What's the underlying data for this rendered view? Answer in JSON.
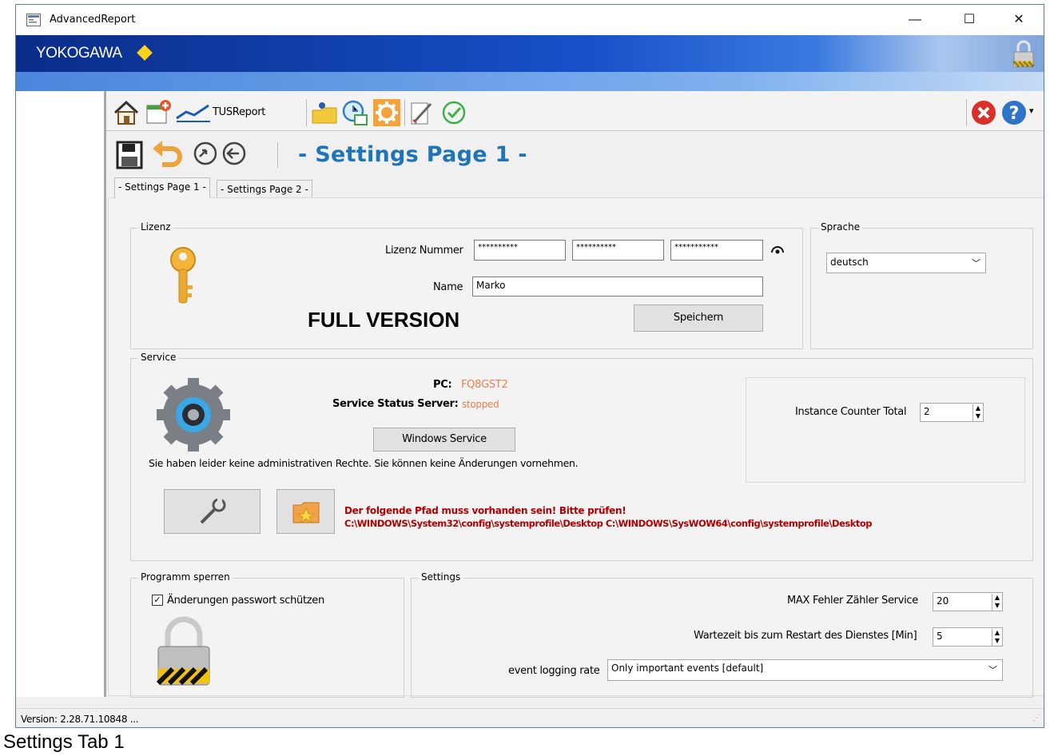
{
  "window": {
    "title": "AdvancedReport",
    "minimize": "—",
    "maximize": "☐",
    "close": "✕"
  },
  "banner": {
    "brand": "YOKOGAWA"
  },
  "toolbar": {
    "tusreport_label": "TUSReport"
  },
  "pagebar": {
    "title": "- Settings Page 1 -"
  },
  "tabs": [
    {
      "label": "- Settings Page 1 -"
    },
    {
      "label": "- Settings Page 2 -"
    }
  ],
  "lizenz": {
    "group_label": "Lizenz",
    "nummer_label": "Lizenz Nummer",
    "nummer_values": [
      "**********",
      "**********",
      "***********"
    ],
    "name_label": "Name",
    "name_value": "Marko",
    "version_text": "FULL VERSION",
    "save_button": "Speichern"
  },
  "sprache": {
    "group_label": "Sprache",
    "selected": "deutsch"
  },
  "service": {
    "group_label": "Service",
    "pc_label": "PC:",
    "pc_value": "FQ8GST2",
    "status_label": "Service Status Server:",
    "status_value": "stopped",
    "windows_service_button": "Windows Service",
    "rights_message": "Sie haben leider keine administrativen Rechte. Sie können keine Änderungen vornehmen.",
    "path_warning": "Der folgende Pfad muss vorhanden sein! Bitte prüfen!",
    "path_value": "C:\\WINDOWS\\System32\\config\\systemprofile\\Desktop  C:\\WINDOWS\\SysWOW64\\config\\systemprofile\\Desktop",
    "instance_label": "Instance Counter Total",
    "instance_value": "2"
  },
  "lock": {
    "group_label": "Programm sperren",
    "checkbox_label": "Änderungen passwort schützen",
    "checked": true
  },
  "settings": {
    "group_label": "Settings",
    "max_fehler_label": "MAX Fehler Zähler Service",
    "max_fehler_value": "20",
    "wartezeit_label": "Wartezeit bis zum Restart des Dienstes [Min]",
    "wartezeit_value": "5",
    "logging_label": "event logging rate",
    "logging_value": "Only important events [default]"
  },
  "status": {
    "version": "Version: 2.28.71.10848  ..."
  },
  "caption": "Settings Tab 1",
  "colors": {
    "accent_title": "#1f73b7",
    "value_orange": "#f07d4a",
    "warning_red": "#b20000",
    "banner_blue": "#0a2d88"
  }
}
